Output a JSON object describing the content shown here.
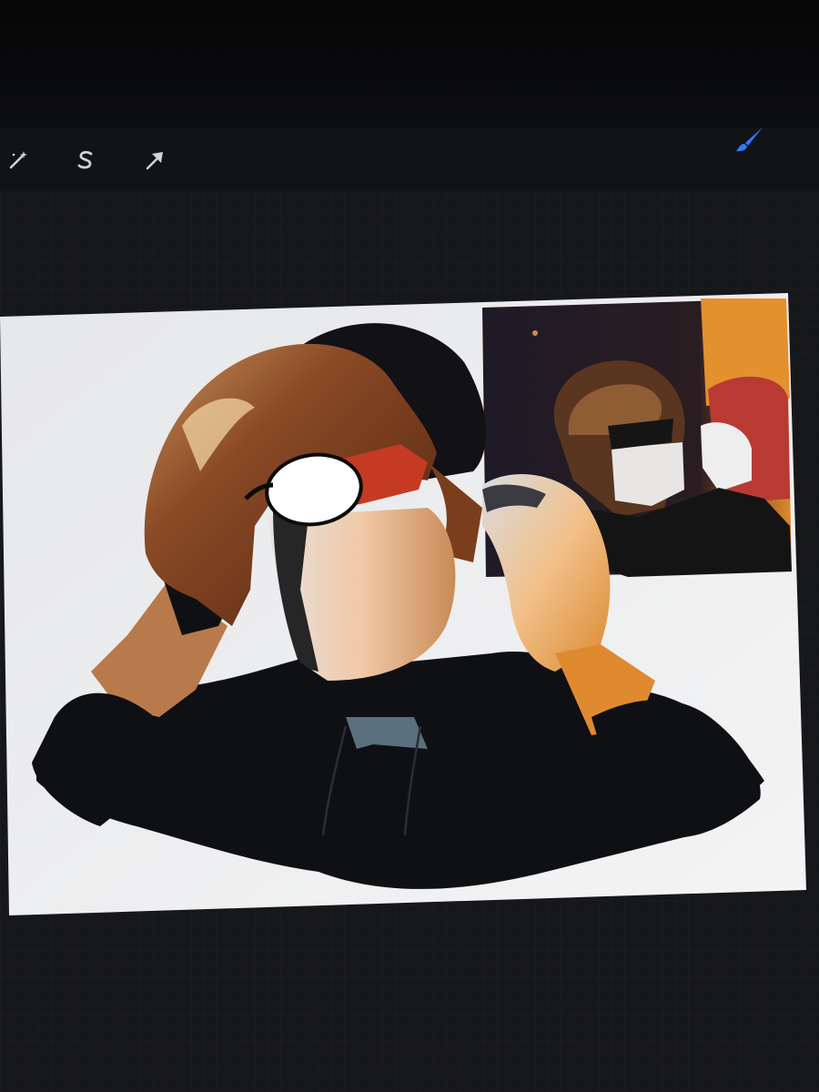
{
  "app": {
    "toolbar": {
      "tools": [
        {
          "name": "adjustments",
          "icon": "magic-wand-icon"
        },
        {
          "name": "selection",
          "icon": "selection-s-icon"
        },
        {
          "name": "transform",
          "icon": "arrow-cursor-icon"
        },
        {
          "name": "brush",
          "icon": "brush-icon",
          "active": true
        }
      ],
      "accent_color": "#2f7bff"
    },
    "canvas": {
      "background": "#f2f2f2",
      "reference_photo": true
    }
  }
}
